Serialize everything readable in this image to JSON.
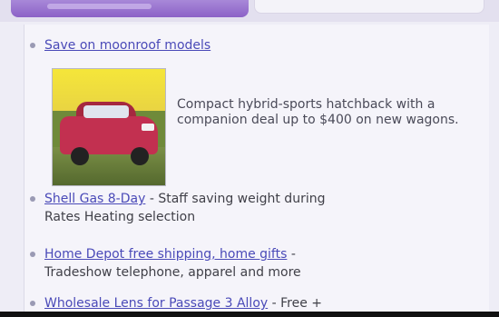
{
  "deals": [
    {
      "link": "Save on moonroof models",
      "text": "",
      "description": "Compact hybrid-sports hatchback with a companion deal up to $400 on new wagons."
    },
    {
      "link": "Shell Gas 8-Day",
      "text": " - Staff saving weight during",
      "text2": "Rates Heating selection"
    },
    {
      "link": "Home Depot free shipping, home gifts",
      "text": " -",
      "text2": "Tradeshow telephone, apparel and more"
    },
    {
      "link": "Wholesale Lens for Passage 3 Alloy",
      "text": " - Free +"
    }
  ],
  "image": {
    "icon": "car-photo"
  },
  "colors": {
    "tab_accent": "#8c62c7",
    "link": "#4a4ab8",
    "background": "#eeedf6"
  }
}
